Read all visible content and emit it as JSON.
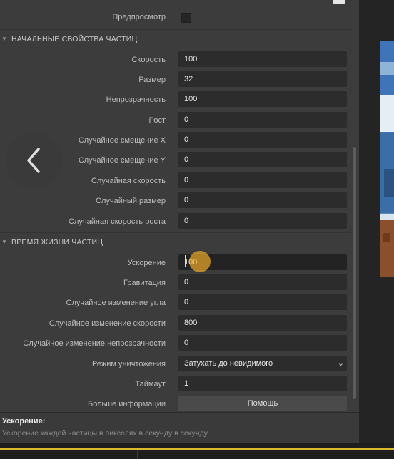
{
  "preview_row": {
    "label": "Предпросмотр",
    "checked": false
  },
  "sections": {
    "initial": {
      "title": "НАЧАЛЬНЫЕ СВОЙСТВА ЧАСТИЦ"
    },
    "lifetime": {
      "title": "ВРЕМЯ ЖИЗНИ ЧАСТИЦ"
    }
  },
  "initial_props": [
    {
      "label": "Скорость",
      "value": "100"
    },
    {
      "label": "Размер",
      "value": "32"
    },
    {
      "label": "Непрозрачность",
      "value": "100"
    },
    {
      "label": "Рост",
      "value": "0"
    },
    {
      "label": "Случайное смещение X",
      "value": "0"
    },
    {
      "label": "Случайное смещение Y",
      "value": "0"
    },
    {
      "label": "Случайная скорость",
      "value": "0"
    },
    {
      "label": "Случайный размер",
      "value": "0"
    },
    {
      "label": "Случайная скорость роста",
      "value": "0"
    }
  ],
  "lifetime_props": [
    {
      "label": "Ускорение",
      "value": "100"
    },
    {
      "label": "Гравитация",
      "value": "0"
    },
    {
      "label": "Случайное изменение угла",
      "value": "0"
    },
    {
      "label": "Случайное изменение скорости",
      "value": "800"
    },
    {
      "label": "Случайное изменение непрозрачности",
      "value": "0"
    }
  ],
  "destroy_mode": {
    "label": "Режим уничтожения",
    "value": "Затухать до невидимого"
  },
  "timeout": {
    "label": "Таймаут",
    "value": "1"
  },
  "more_info": {
    "label": "Больше информации",
    "button": "Помощь"
  },
  "info_panel": {
    "title": "Ускорение:",
    "description": "Ускорение каждой частицы в пикселях в секунду в секунду."
  },
  "icons": {
    "back": "chevron-left-icon",
    "collapse": "triangle-down-icon",
    "dropdown": "chevron-down-icon"
  },
  "colors": {
    "accent_highlight": "#ecaa28",
    "bottom_accent": "#d9b92e"
  }
}
